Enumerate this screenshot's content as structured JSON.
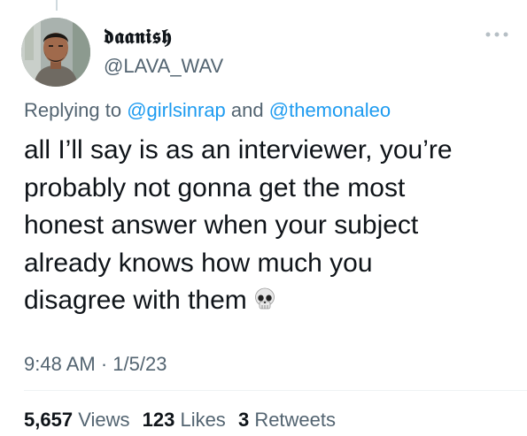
{
  "tweet": {
    "display_name": "𝖉𝖆𝖆𝖓𝖎𝖘𝖍",
    "handle": "@LAVA_WAV",
    "more_icon": "more-horizontal-icon",
    "replying_prefix": "Replying to",
    "reply_mention_1": "@girlsinrap",
    "reply_connector": "and",
    "reply_mention_2": "@themonaleo",
    "text": "all I’ll say is as an interviewer, you’re\nprobably not gonna get the most\nhonest answer when your subject\nalready knows how much you\ndisagree with them",
    "emoji": "skull-emoji",
    "time": "9:48 AM",
    "separator": "·",
    "date": "1/5/23",
    "views_count": "5,657",
    "views_label": "Views",
    "likes_count": "123",
    "likes_label": "Likes",
    "retweets_count": "3",
    "retweets_label": "Retweets"
  },
  "colors": {
    "text": "#0f1419",
    "secondary": "#536471",
    "link": "#1d9bf0",
    "divider": "#eff3f4"
  }
}
